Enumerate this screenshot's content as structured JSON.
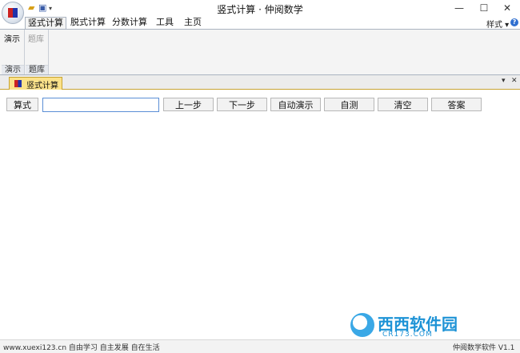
{
  "window": {
    "title": "竖式计算 · 仲阅数学",
    "min_glyph": "—",
    "max_glyph": "☐",
    "close_glyph": "✕"
  },
  "qat": {
    "open_icon": "▰",
    "save_icon": "▣",
    "dropdown_icon": "▾"
  },
  "ribbon_tabs": [
    {
      "label": "竖式计算",
      "active": true
    },
    {
      "label": "脱式计算",
      "active": false
    },
    {
      "label": "分数计算",
      "active": false
    },
    {
      "label": "工具",
      "active": false
    },
    {
      "label": "主页",
      "active": false
    }
  ],
  "style_menu": "样式 ▾",
  "help_icon": "?",
  "ribbon_groups": [
    {
      "button": "演示",
      "label": "演示",
      "dim": false
    },
    {
      "button": "题库",
      "label": "题库",
      "dim": true
    }
  ],
  "doc_tab": {
    "label": "竖式计算",
    "dropdown": "▾",
    "close": "✕"
  },
  "toolbar": {
    "expr_button": "算式",
    "input_value": "",
    "buttons": [
      "上一步",
      "下一步",
      "自动演示",
      "自测",
      "清空",
      "答案"
    ]
  },
  "status": {
    "left": "www.xuexi123.cn 自由学习 自主发展 自在生活",
    "right": "仲阅数学软件 V1.1"
  },
  "watermark": {
    "text": "西西软件园",
    "sub": "CR173.COM"
  },
  "colors": {
    "doc_tab": "#fbe28a",
    "accent_border": "#c8a432",
    "ribbon_bg": "#f4f4f4"
  }
}
